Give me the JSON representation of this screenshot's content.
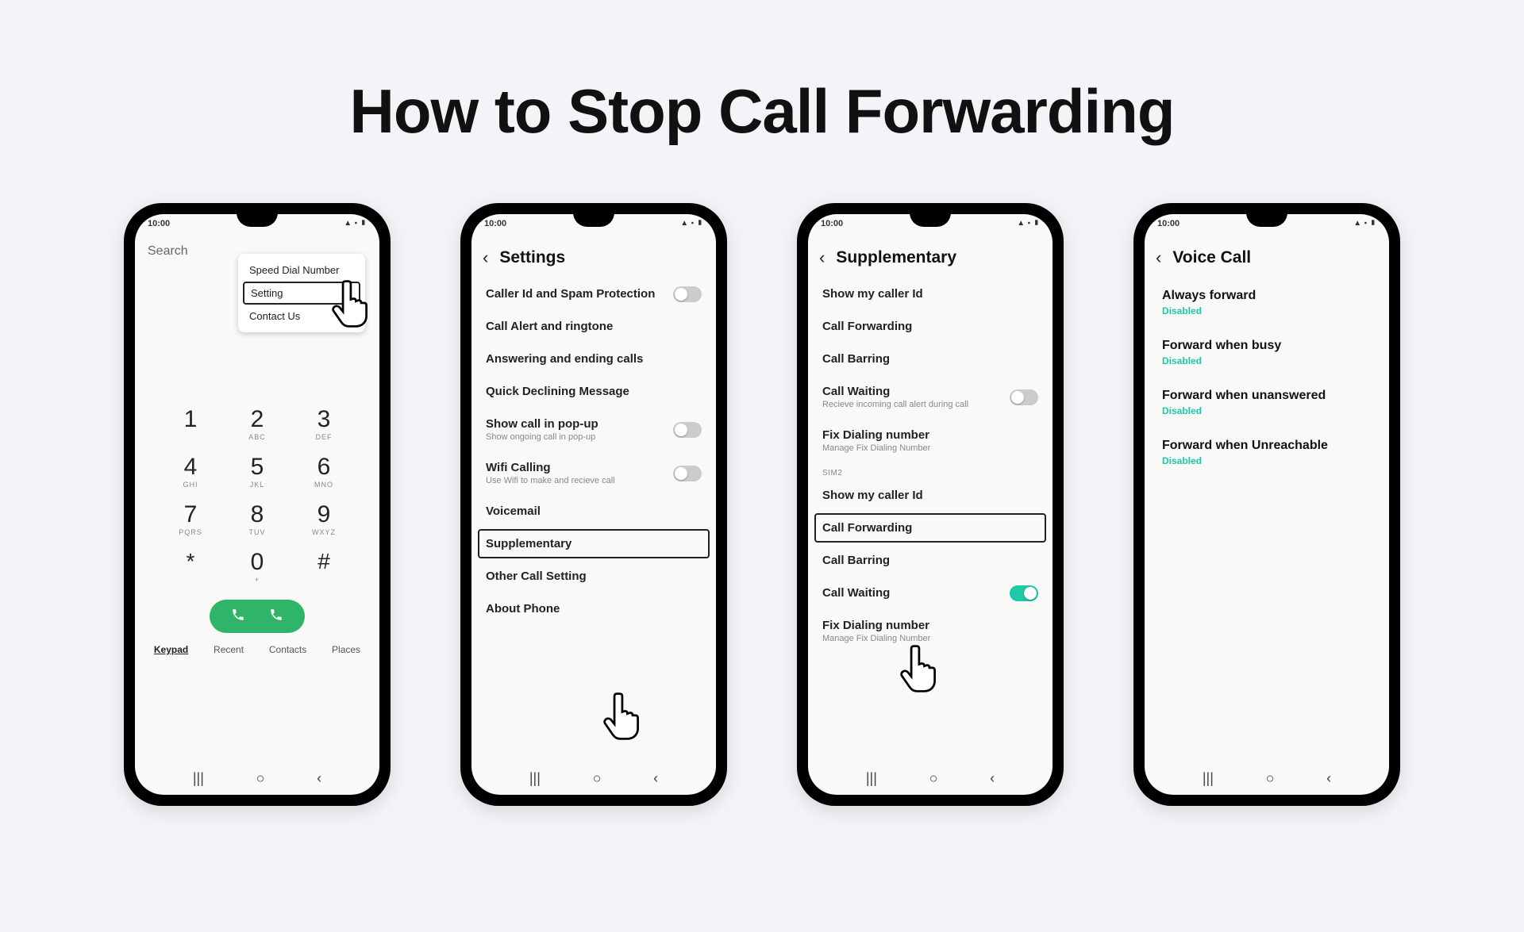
{
  "title": "How to Stop Call Forwarding",
  "status_time": "10:00",
  "phone1": {
    "search": "Search",
    "menu": {
      "speed_dial": "Speed Dial Number",
      "setting": "Setting",
      "contact": "Contact Us"
    },
    "keys": {
      "1": {
        "n": "1",
        "s": ""
      },
      "2": {
        "n": "2",
        "s": "ABC"
      },
      "3": {
        "n": "3",
        "s": "DEF"
      },
      "4": {
        "n": "4",
        "s": "GHI"
      },
      "5": {
        "n": "5",
        "s": "JKL"
      },
      "6": {
        "n": "6",
        "s": "MNO"
      },
      "7": {
        "n": "7",
        "s": "PQRS"
      },
      "8": {
        "n": "8",
        "s": "TUV"
      },
      "9": {
        "n": "9",
        "s": "WXYZ"
      },
      "star": {
        "n": "*",
        "s": ""
      },
      "0": {
        "n": "0",
        "s": "+"
      },
      "hash": {
        "n": "#",
        "s": ""
      }
    },
    "tabs": {
      "keypad": "Keypad",
      "recent": "Recent",
      "contacts": "Contacts",
      "places": "Places"
    }
  },
  "phone2": {
    "header": "Settings",
    "items": {
      "caller_id": "Caller Id and Spam Protection",
      "call_alert": "Call Alert and  ringtone",
      "answering": "Answering and ending calls",
      "quick_decline": "Quick Declining Message",
      "show_popup": "Show call in pop-up",
      "show_popup_sub": "Show ongoing call in pop-up",
      "wifi_calling": "Wifi Calling",
      "wifi_calling_sub": "Use Wifi to make and recieve call",
      "voicemail": "Voicemail",
      "supplementary": "Supplementary",
      "other": "Other Call Setting",
      "about": "About Phone"
    }
  },
  "phone3": {
    "header": "Supplementary",
    "sim2_label": "SIM2",
    "items": {
      "show_caller_1": "Show my caller Id",
      "call_forwarding_1": "Call Forwarding",
      "call_barring_1": "Call Barring",
      "call_waiting_1": "Call Waiting",
      "call_waiting_sub": "Recieve incoming call alert during call",
      "fix_dialing_1": "Fix Dialing number",
      "fix_dialing_sub": "Manage Fix Dialing Number",
      "show_caller_2": "Show my caller Id",
      "call_forwarding_2": "Call Forwarding",
      "call_barring_2": "Call Barring",
      "call_waiting_2": "Call Waiting",
      "fix_dialing_2": "Fix Dialing number",
      "fix_dialing_2_sub": "Manage Fix Dialing Number"
    }
  },
  "phone4": {
    "header": "Voice Call",
    "disabled": "Disabled",
    "items": {
      "always": "Always forward",
      "busy": "Forward when busy",
      "unanswered": "Forward when unanswered",
      "unreachable": "Forward when Unreachable"
    }
  }
}
